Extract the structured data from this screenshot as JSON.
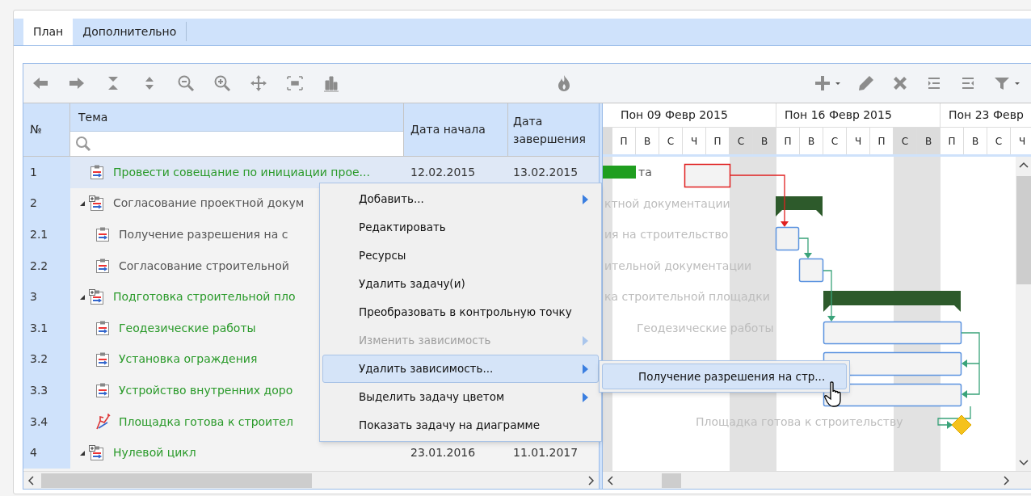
{
  "tabs": [
    {
      "label": "План",
      "selected": true
    },
    {
      "label": "Дополнительно",
      "selected": false
    }
  ],
  "grid": {
    "columns": [
      "№",
      "Тема",
      "Дата начала",
      "Дата завершения"
    ],
    "rows": [
      {
        "number": "1",
        "subject": "Провести совещание по инициации прое...",
        "start": "12.02.2015",
        "end": "13.02.2015",
        "kind": "task",
        "color": "#2a9a2a",
        "selected": true
      },
      {
        "number": "2",
        "subject": "Согласование проектной докум",
        "kind": "summary",
        "expanded": true,
        "color": "#555555",
        "selected": false,
        "children": [
          {
            "number": "2.1",
            "subject": "Получение разрешения на с",
            "kind": "task",
            "color": "#555555",
            "selected": false
          },
          {
            "number": "2.2",
            "subject": "Согласование строительной",
            "kind": "task",
            "color": "#555555",
            "selected": false
          }
        ]
      },
      {
        "number": "3",
        "subject": "Подготовка строительной пло",
        "kind": "summary",
        "expanded": true,
        "color": "#2a9a2a",
        "selected": false,
        "children": [
          {
            "number": "3.1",
            "subject": "Геодезические работы",
            "kind": "task",
            "color": "#2a9a2a",
            "selected": false
          },
          {
            "number": "3.2",
            "subject": "Установка ограждения",
            "kind": "task",
            "color": "#2a9a2a",
            "selected": false
          },
          {
            "number": "3.3",
            "subject": "Устройство внутренних доро",
            "kind": "task",
            "color": "#2a9a2a",
            "selected": false
          },
          {
            "number": "3.4",
            "subject": "Площадка готова к строител",
            "kind": "milestone",
            "color": "#2a9a2a",
            "selected": false
          }
        ]
      },
      {
        "number": "4",
        "subject": "Нулевой цикл",
        "start": "23.01.2016",
        "end": "11.01.2017",
        "kind": "summary",
        "expanded": true,
        "color": "#2a9a2a",
        "selected": false
      }
    ]
  },
  "gantt": {
    "weeks": [
      {
        "label": "Пон 09 Февр 2015",
        "days": [
          {
            "label": "П",
            "weekend": false
          },
          {
            "label": "В",
            "weekend": false
          },
          {
            "label": "С",
            "weekend": false
          },
          {
            "label": "Ч",
            "weekend": false
          },
          {
            "label": "П",
            "weekend": false
          },
          {
            "label": "С",
            "weekend": true
          },
          {
            "label": "В",
            "weekend": true
          }
        ]
      },
      {
        "label": "Пон 16 Февр 2015",
        "days": [
          {
            "label": "П",
            "weekend": false
          },
          {
            "label": "В",
            "weekend": false
          },
          {
            "label": "С",
            "weekend": false
          },
          {
            "label": "Ч",
            "weekend": false
          },
          {
            "label": "П",
            "weekend": false
          },
          {
            "label": "С",
            "weekend": true
          },
          {
            "label": "В",
            "weekend": true
          }
        ]
      },
      {
        "label": "Пон 23 Февр",
        "days": [
          {
            "label": "П",
            "weekend": false
          },
          {
            "label": "В",
            "weekend": false
          },
          {
            "label": "С",
            "weekend": false
          },
          {
            "label": "Ч",
            "weekend": false
          }
        ]
      }
    ],
    "bar_labels": [
      "та",
      "ктной документации",
      "ия на строительство",
      "ительной документации",
      "ка строительной площадки",
      "Геодезические работы",
      "Площадка готова к строительству"
    ]
  },
  "context_menu": {
    "items": [
      {
        "label": "Добавить...",
        "submenu": true,
        "disabled": false,
        "selected": false
      },
      {
        "label": "Редактировать",
        "submenu": false,
        "disabled": false,
        "selected": false
      },
      {
        "label": "Ресурсы",
        "submenu": false,
        "disabled": false,
        "selected": false
      },
      {
        "label": "Удалить задачу(и)",
        "submenu": false,
        "disabled": false,
        "selected": false
      },
      {
        "label": "Преобразовать в контрольную точку",
        "submenu": false,
        "disabled": false,
        "selected": false
      },
      {
        "label": "Изменить зависимость",
        "submenu": true,
        "disabled": true,
        "selected": false
      },
      {
        "label": "Удалить зависимость...",
        "submenu": true,
        "disabled": false,
        "selected": true
      },
      {
        "label": "Выделить задачу цветом",
        "submenu": true,
        "disabled": false,
        "selected": false
      },
      {
        "label": "Показать задачу на диаграмме",
        "submenu": false,
        "disabled": false,
        "selected": false
      }
    ]
  },
  "submenu": {
    "items": [
      {
        "label": "Получение разрешения на стр...",
        "selected": true
      }
    ]
  }
}
